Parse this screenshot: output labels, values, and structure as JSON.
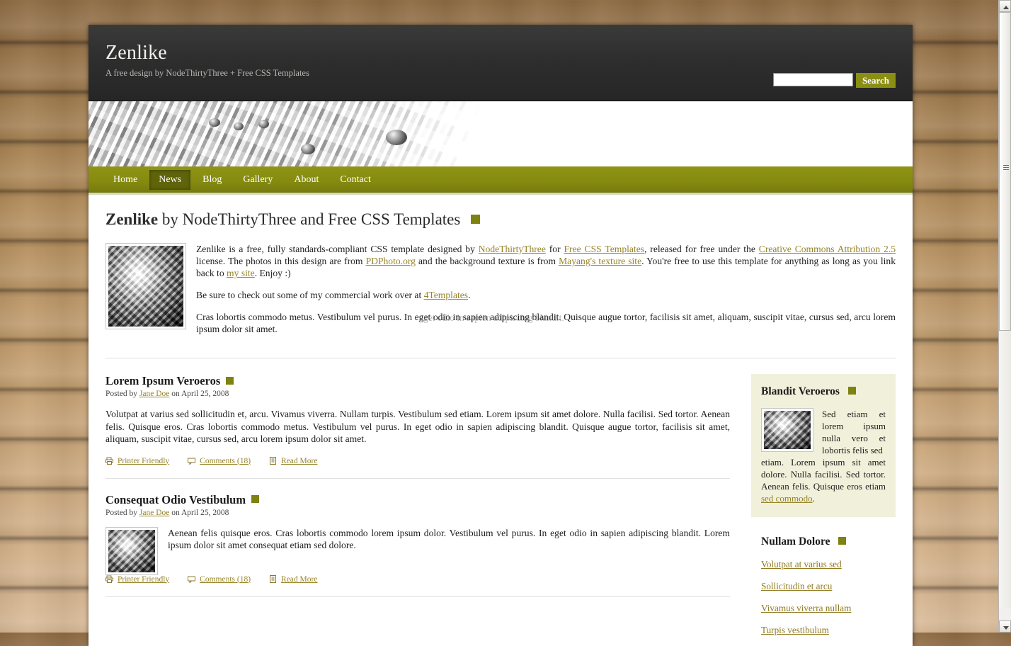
{
  "site": {
    "title": "Zenlike",
    "tagline": "A free design by NodeThirtyThree + Free CSS Templates"
  },
  "search": {
    "value": "",
    "placeholder": "",
    "button_label": "Search"
  },
  "nav": {
    "items": [
      {
        "label": "Home",
        "active": false
      },
      {
        "label": "News",
        "active": true
      },
      {
        "label": "Blog",
        "active": false
      },
      {
        "label": "Gallery",
        "active": false
      },
      {
        "label": "About",
        "active": false
      },
      {
        "label": "Contact",
        "active": false
      }
    ]
  },
  "page": {
    "title_bold": "Zenlike",
    "title_rest": " by NodeThirtyThree and Free CSS Templates"
  },
  "intro": {
    "p1_a": "Zenlike is a free, fully standards-compliant CSS template designed by ",
    "link_n33": "NodeThirtyThree",
    "p1_b": " for ",
    "link_fct": "Free CSS Templates",
    "p1_c": ", released for free under the ",
    "link_cc": "Creative Commons Attribution 2.5",
    "p1_d": " license. The photos in this design are from ",
    "link_pdphoto": "PDPhoto.org",
    "p1_e": " and the background texture is from ",
    "link_mayang": "Mayang's texture site",
    "p1_f": ". You're free to use this template for anything as long as you link back to ",
    "link_mysite": "my site",
    "p1_g": ". Enjoy :)",
    "p2_a": "Be sure to check out some of my commercial work over at ",
    "link_4templates": "4Templates",
    "p2_b": ".",
    "p3": "Cras lobortis commodo metus. Vestibulum vel purus. In eget odio in sapien adipiscing blandit. Quisque augue tortor, facilisis sit amet, aliquam, suscipit vitae, cursus sed, arcu lorem ipsum dolor sit amet.",
    "ghost_text": "eget odio in sapien adipiscing blandit."
  },
  "posts": [
    {
      "title": "Lorem Ipsum Veroeros",
      "meta_prefix": "Posted by ",
      "author": "Jane Doe",
      "meta_suffix": " on April 25, 2008",
      "body": "Volutpat at varius sed sollicitudin et, arcu. Vivamus viverra. Nullam turpis. Vestibulum sed etiam. Lorem ipsum sit amet dolore. Nulla facilisi. Sed tortor. Aenean felis. Quisque eros. Cras lobortis commodo metus. Vestibulum vel purus. In eget odio in sapien adipiscing blandit. Quisque augue tortor, facilisis sit amet, aliquam, suscipit vitae, cursus sed, arcu lorem ipsum dolor sit amet.",
      "has_thumb": false,
      "links": [
        {
          "label": "Printer Friendly",
          "icon": "printer-icon"
        },
        {
          "label": "Comments (18)",
          "icon": "comment-icon"
        },
        {
          "label": "Read More",
          "icon": "document-icon"
        }
      ]
    },
    {
      "title": "Consequat Odio Vestibulum",
      "meta_prefix": "Posted by ",
      "author": "Jane Doe",
      "meta_suffix": " on April 25, 2008",
      "body": "Aenean felis quisque eros. Cras lobortis commodo lorem ipsum dolor. Vestibulum vel purus. In eget odio in sapien adipiscing blandit. Lorem ipsum dolor sit amet consequat etiam sed dolore.",
      "has_thumb": true,
      "links": [
        {
          "label": "Printer Friendly",
          "icon": "printer-icon"
        },
        {
          "label": "Comments (18)",
          "icon": "comment-icon"
        },
        {
          "label": "Read More",
          "icon": "document-icon"
        }
      ]
    }
  ],
  "sidebar": {
    "blandit": {
      "title": "Blandit Veroeros",
      "text_a": "Sed etiam et lorem ipsum nulla vero et lobortis felis sed etiam. Lorem ipsum sit amet dolore. Nulla facilisi. Sed tortor. Aenean felis. Quisque eros etiam ",
      "link": "sed commodo",
      "text_b": "."
    },
    "nullam": {
      "title": "Nullam Dolore",
      "links": [
        "Volutpat at varius sed",
        "Sollicitudin et arcu",
        "Vivamus viverra nullam",
        "Turpis vestibulum"
      ]
    }
  },
  "colors": {
    "olive": "#7d8211",
    "nav_olive": "#868b10",
    "nav_active": "#5f6309",
    "link_gold": "#8f7a20",
    "sidebar_cream": "#f1f0da",
    "header_dark": "#2e2e2e"
  }
}
